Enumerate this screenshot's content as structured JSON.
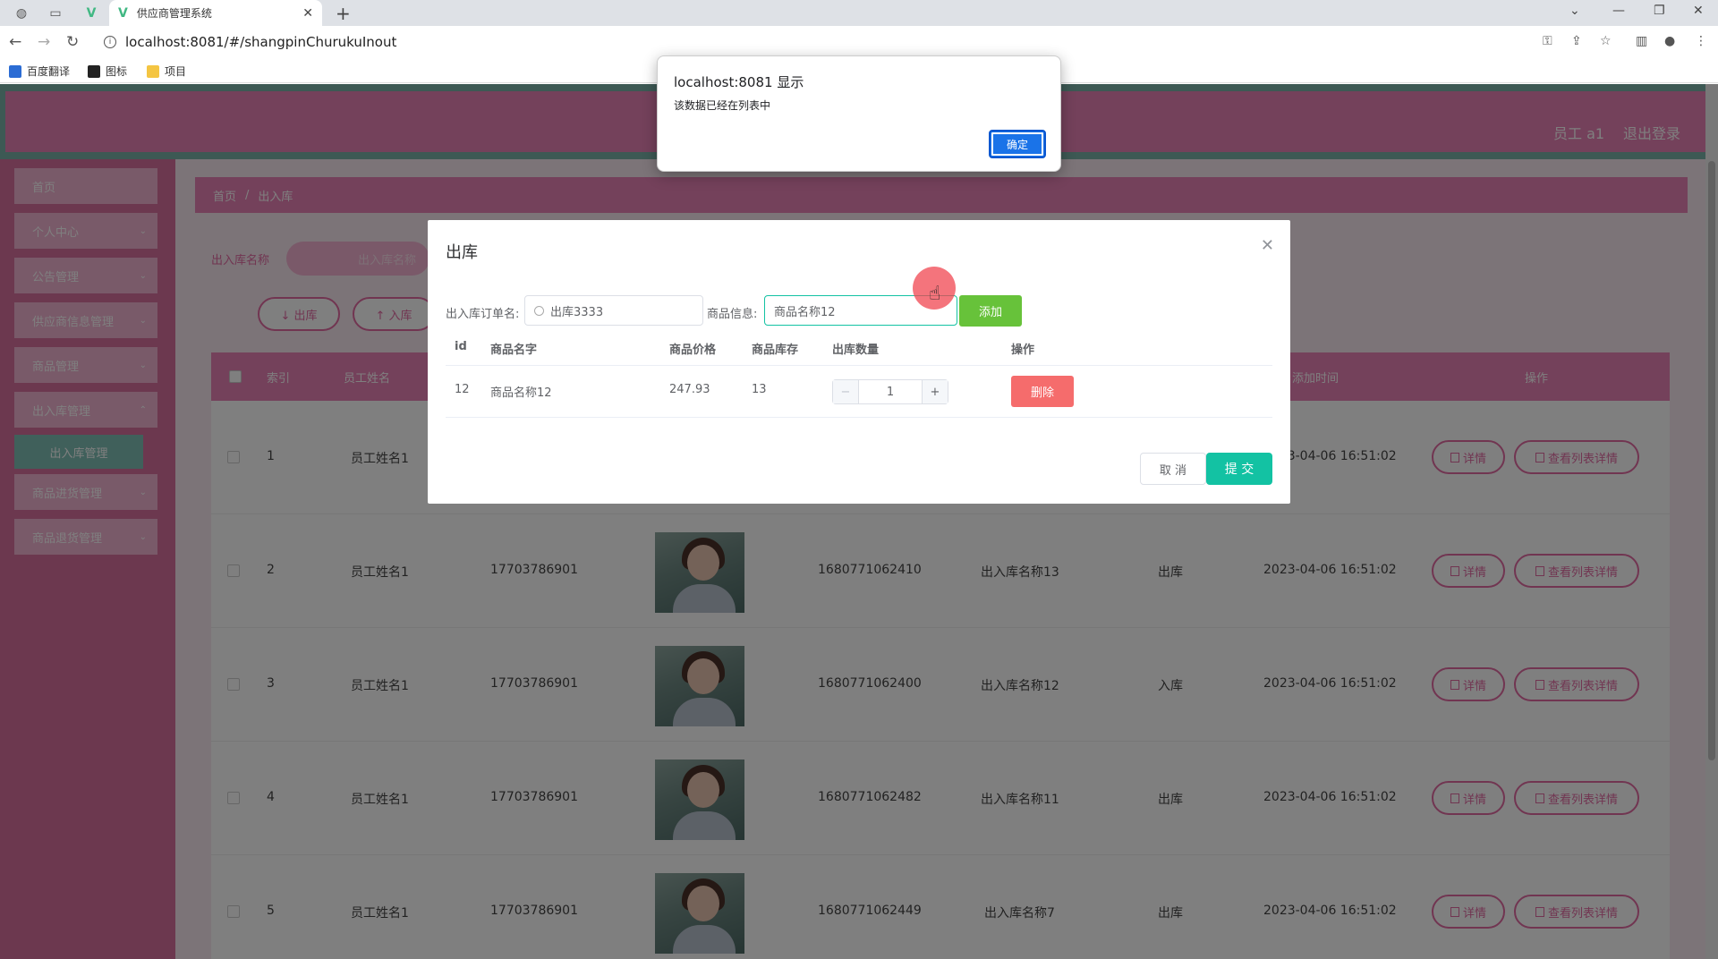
{
  "browser": {
    "tab_title": "供应商管理系统",
    "url": "localhost:8081/#/shangpinChurukuInout",
    "bookmarks": [
      "百度翻译",
      "图标",
      "项目"
    ]
  },
  "header": {
    "user": "员工 a1",
    "logout": "退出登录"
  },
  "sidebar": {
    "items": [
      {
        "label": "首页"
      },
      {
        "label": "个人中心"
      },
      {
        "label": "公告管理"
      },
      {
        "label": "供应商信息管理"
      },
      {
        "label": "商品管理"
      },
      {
        "label": "出入库管理"
      },
      {
        "label": "商品进货管理"
      },
      {
        "label": "商品退货管理"
      }
    ],
    "active_sub": "出入库管理"
  },
  "breadcrumb": [
    "首页",
    "出入库"
  ],
  "search": {
    "label": "出入库名称",
    "placeholder": "出入库名称"
  },
  "ops": {
    "out_label": "↓ 出库",
    "in_label": "↑ 入库"
  },
  "table": {
    "headers": [
      "索引",
      "员工姓名",
      "添加时间",
      "操作"
    ],
    "rows": [
      {
        "index": "1",
        "name": "员工姓名1",
        "phone": "",
        "code": "",
        "item": "",
        "type": "",
        "time": "2023-04-06 16:51:02"
      },
      {
        "index": "2",
        "name": "员工姓名1",
        "phone": "17703786901",
        "code": "1680771062410",
        "item": "出入库名称13",
        "type": "出库",
        "time": "2023-04-06 16:51:02"
      },
      {
        "index": "3",
        "name": "员工姓名1",
        "phone": "17703786901",
        "code": "1680771062400",
        "item": "出入库名称12",
        "type": "入库",
        "time": "2023-04-06 16:51:02"
      },
      {
        "index": "4",
        "name": "员工姓名1",
        "phone": "17703786901",
        "code": "1680771062482",
        "item": "出入库名称11",
        "type": "出库",
        "time": "2023-04-06 16:51:02"
      },
      {
        "index": "5",
        "name": "员工姓名1",
        "phone": "17703786901",
        "code": "1680771062449",
        "item": "出入库名称7",
        "type": "出库",
        "time": "2023-04-06 16:51:02"
      }
    ],
    "detail_label": "详情",
    "list_detail_label": "查看列表详情"
  },
  "dialog": {
    "title": "出库",
    "order_label": "出入库订单名:",
    "order_value": "出库3333",
    "goods_label": "商品信息:",
    "goods_value": "商品名称12",
    "add_label": "添加",
    "columns": [
      "id",
      "商品名字",
      "商品价格",
      "商品库存",
      "出库数量",
      "操作"
    ],
    "row": {
      "id": "12",
      "name": "商品名称12",
      "price": "247.93",
      "stock": "13",
      "qty": "1"
    },
    "delete_label": "删除",
    "cancel_label": "取 消",
    "submit_label": "提 交",
    "minus": "−",
    "plus": "+"
  },
  "alert": {
    "title": "localhost:8081 显示",
    "message": "该数据已经在列表中",
    "ok_label": "确定"
  }
}
